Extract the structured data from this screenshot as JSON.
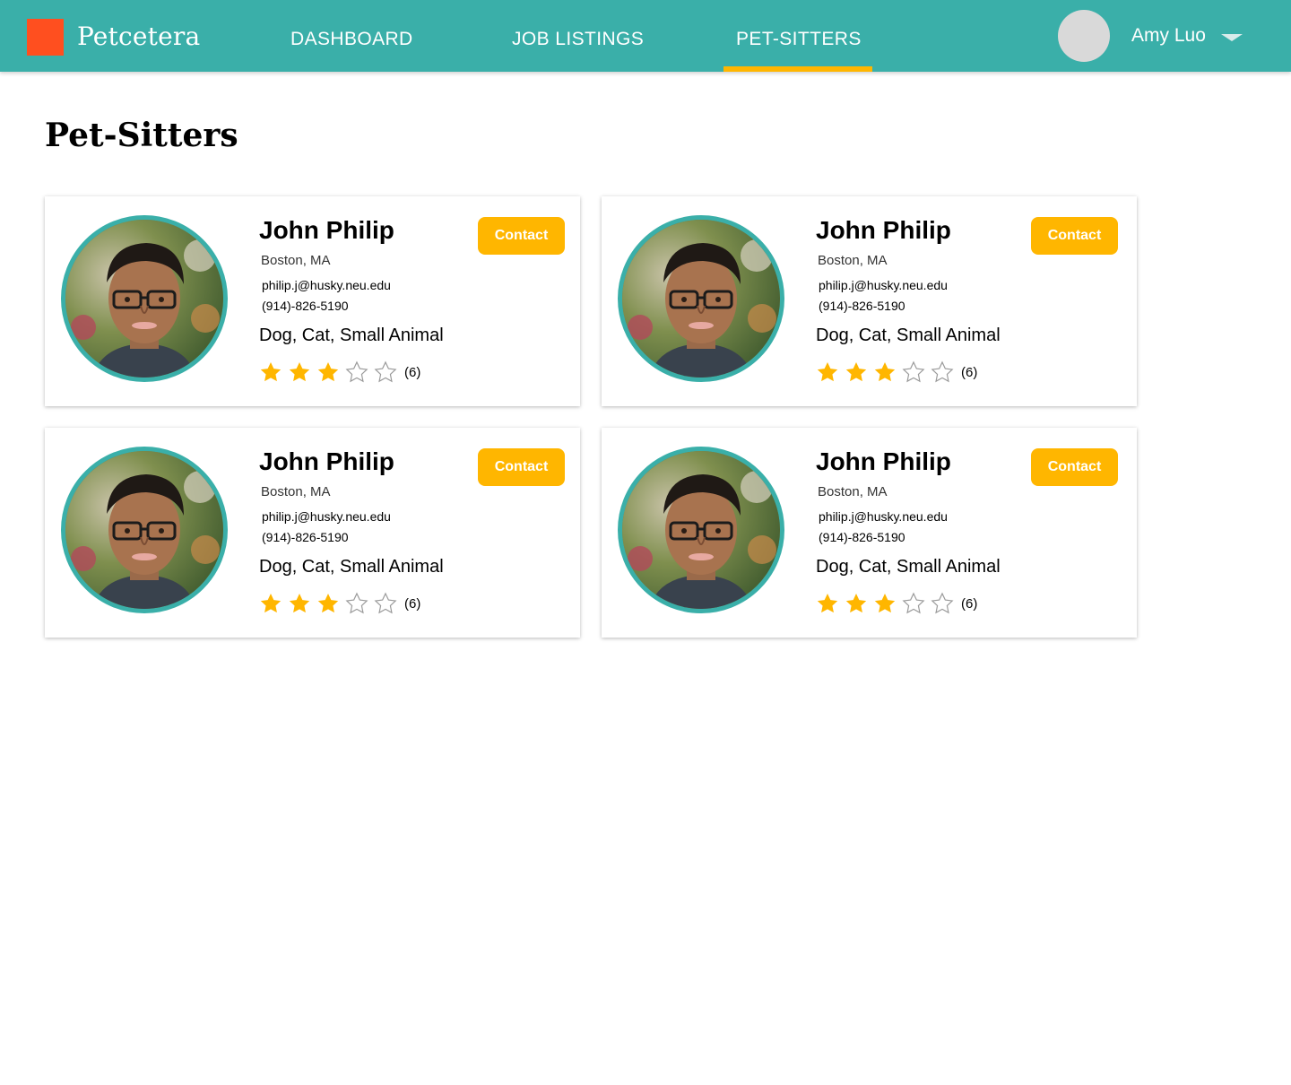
{
  "brand": {
    "name": "Petcetera",
    "logo_color": "#ff4f1f"
  },
  "nav": {
    "tabs": [
      {
        "label": "DASHBOARD",
        "active": false
      },
      {
        "label": "JOB LISTINGS",
        "active": false
      },
      {
        "label": "PET-SITTERS",
        "active": true
      }
    ]
  },
  "user": {
    "name": "Amy Luo"
  },
  "page": {
    "title": "Pet-Sitters"
  },
  "colors": {
    "header": "#3aafa9",
    "accent": "#ffb600",
    "star_filled": "#ffb600",
    "star_empty": "#9a9a9a"
  },
  "sitters": [
    {
      "name": "John Philip",
      "location": "Boston, MA",
      "email": "philip.j@husky.neu.edu",
      "phone": "(914)-826-5190",
      "pets": "Dog, Cat, Small Animal",
      "rating": 3,
      "max_rating": 5,
      "review_count": "(6)",
      "contact_label": "Contact"
    },
    {
      "name": "John Philip",
      "location": "Boston, MA",
      "email": "philip.j@husky.neu.edu",
      "phone": "(914)-826-5190",
      "pets": "Dog, Cat, Small Animal",
      "rating": 3,
      "max_rating": 5,
      "review_count": "(6)",
      "contact_label": "Contact"
    },
    {
      "name": "John Philip",
      "location": "Boston, MA",
      "email": "philip.j@husky.neu.edu",
      "phone": "(914)-826-5190",
      "pets": "Dog, Cat, Small Animal",
      "rating": 3,
      "max_rating": 5,
      "review_count": "(6)",
      "contact_label": "Contact"
    },
    {
      "name": "John Philip",
      "location": "Boston, MA",
      "email": "philip.j@husky.neu.edu",
      "phone": "(914)-826-5190",
      "pets": "Dog, Cat, Small Animal",
      "rating": 3,
      "max_rating": 5,
      "review_count": "(6)",
      "contact_label": "Contact"
    }
  ]
}
